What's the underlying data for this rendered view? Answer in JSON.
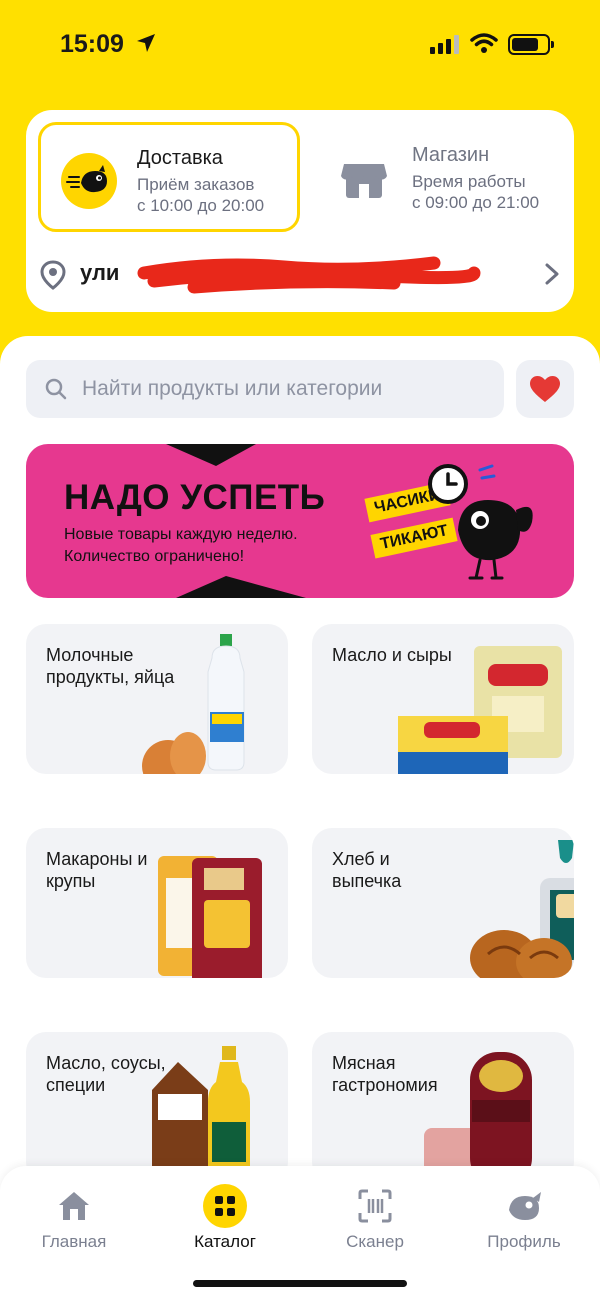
{
  "status": {
    "time": "15:09"
  },
  "delivery_card": {
    "delivery": {
      "title": "Доставка",
      "line1": "Приём заказов",
      "line2": "с 10:00 до 20:00"
    },
    "store": {
      "title": "Магазин",
      "line1": "Время работы",
      "line2": "с 09:00 до 21:00"
    },
    "address": "ули"
  },
  "search": {
    "placeholder": "Найти продукты или категории",
    "value": ""
  },
  "banner": {
    "title": "НАДО УСПЕТЬ",
    "line1": "Новые товары каждую неделю.",
    "line2": "Количество ограничено!",
    "tag1": "ЧАСИКИ",
    "tag2": "ТИКАЮТ"
  },
  "categories": [
    {
      "label": "Молочные продукты, яйца"
    },
    {
      "label": "Масло и сыры"
    },
    {
      "label": "Макароны и крупы"
    },
    {
      "label": "Хлеб и выпечка"
    },
    {
      "label": "Масло, соусы, специи"
    },
    {
      "label": "Мясная гастрономия"
    }
  ],
  "nav": [
    {
      "label": "Главная",
      "icon": "home-icon"
    },
    {
      "label": "Каталог",
      "icon": "catalog-icon"
    },
    {
      "label": "Сканер",
      "icon": "scanner-icon"
    },
    {
      "label": "Профиль",
      "icon": "profile-icon"
    }
  ],
  "colors": {
    "brand_yellow": "#ffe000",
    "banner_pink": "#e6388f",
    "heart_red": "#e53935"
  }
}
